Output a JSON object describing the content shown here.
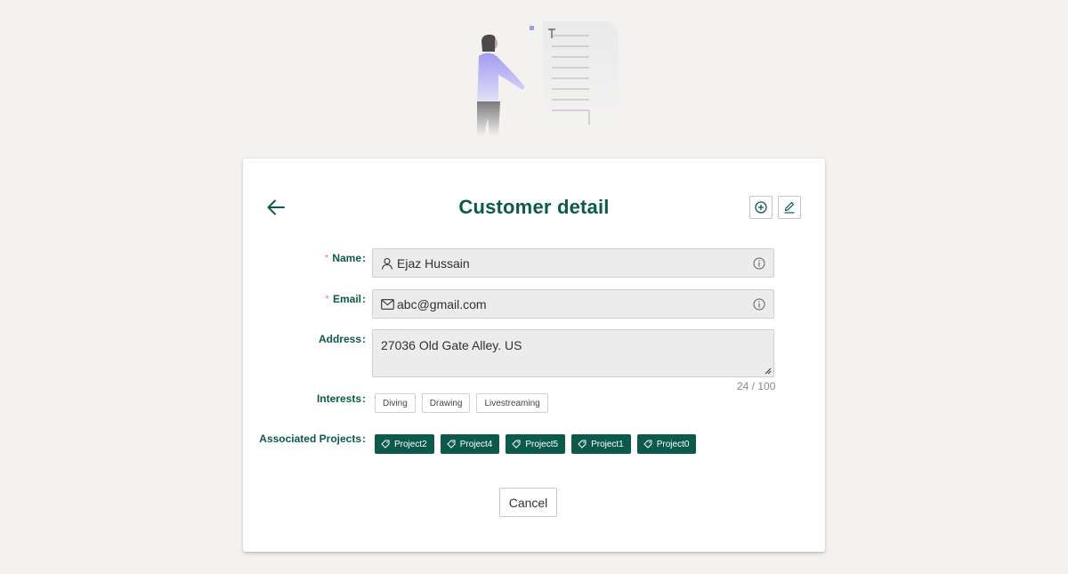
{
  "header": {
    "title": "Customer detail"
  },
  "form": {
    "name": {
      "label": "Name",
      "colon": ":",
      "value": "Ejaz Hussain"
    },
    "email": {
      "label": "Email",
      "colon": ":",
      "value": "abc@gmail.com"
    },
    "address": {
      "label": "Address",
      "colon": ":",
      "value": "27036 Old Gate Alley. US",
      "counter": "24 / 100"
    },
    "interests": {
      "label": "Interests",
      "colon": ":",
      "items": [
        "Diving",
        "Drawing",
        "Livestreaming"
      ]
    },
    "projects": {
      "label": "Associated Projects",
      "colon": ":",
      "items": [
        "Project2",
        "Project4",
        "Project5",
        "Project1",
        "Project0"
      ]
    },
    "required_mark": "*"
  },
  "footer": {
    "cancel_label": "Cancel"
  },
  "colors": {
    "brand": "#0b5a4c",
    "background": "#f3f2f1",
    "required": "#e88888",
    "accent_purple": "#a39bf2"
  },
  "icons": {
    "back": "arrow-left-icon",
    "add": "circle-plus-icon",
    "edit": "pencil-icon",
    "name_field": "person-icon",
    "email_field": "envelope-icon",
    "info": "info-circle-icon",
    "tag": "tag-icon"
  }
}
